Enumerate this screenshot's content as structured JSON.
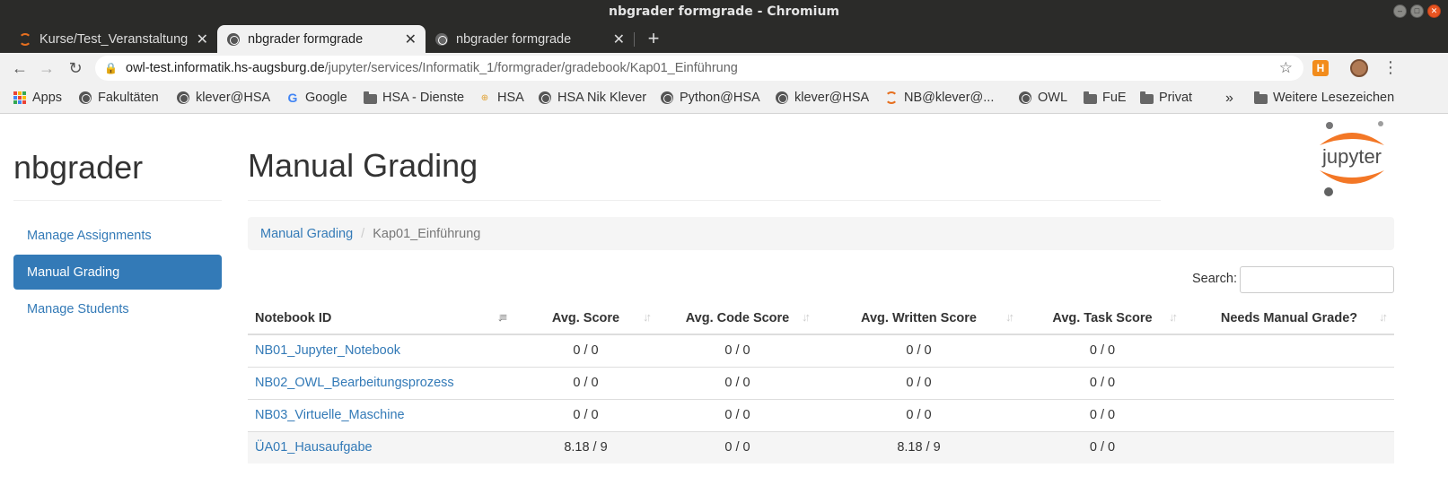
{
  "window": {
    "title": "nbgrader formgrade - Chromium"
  },
  "tabs": [
    {
      "label": "Kurse/Test_Veranstaltung",
      "icon": "jupyter-ring-icon"
    },
    {
      "label": "nbgrader formgrade",
      "icon": "globe-icon"
    },
    {
      "label": "nbgrader formgrade",
      "icon": "globe-icon"
    }
  ],
  "address": {
    "host": "owl-test.informatik.hs-augsburg.de",
    "path": "/jupyter/services/Informatik_1/formgrader/gradebook/Kap01_Einführung"
  },
  "bookmarks": [
    {
      "label": "Apps",
      "icon": "apps-grid-icon"
    },
    {
      "label": "Fakultäten",
      "icon": "globe-icon"
    },
    {
      "label": "klever@HSA",
      "icon": "globe-icon"
    },
    {
      "label": "Google",
      "icon": "google-icon"
    },
    {
      "label": "HSA - Dienste",
      "icon": "folder-icon"
    },
    {
      "label": "HSA",
      "icon": "hsa-icon"
    },
    {
      "label": "HSA Nik Klever",
      "icon": "globe-icon"
    },
    {
      "label": "Python@HSA",
      "icon": "globe-icon"
    },
    {
      "label": "klever@HSA",
      "icon": "globe-icon"
    },
    {
      "label": "NB@klever@...",
      "icon": "jupyter-ring-icon"
    },
    {
      "label": "OWL",
      "icon": "globe-icon"
    },
    {
      "label": "FuE",
      "icon": "folder-icon"
    },
    {
      "label": "Privat",
      "icon": "folder-icon"
    }
  ],
  "bookmarks_overflow": "»",
  "other_bookmarks": "Weitere Lesezeichen",
  "app": {
    "brand": "nbgrader",
    "title": "Manual Grading",
    "logo_text": "jupyter"
  },
  "sidebar": {
    "items": [
      {
        "label": "Manage Assignments",
        "active": false
      },
      {
        "label": "Manual Grading",
        "active": true
      },
      {
        "label": "Manage Students",
        "active": false
      }
    ]
  },
  "breadcrumb": {
    "root": "Manual Grading",
    "separator": "/",
    "current": "Kap01_Einführung"
  },
  "search": {
    "label": "Search:",
    "value": ""
  },
  "table": {
    "columns": [
      "Notebook ID",
      "Avg. Score",
      "Avg. Code Score",
      "Avg. Written Score",
      "Avg. Task Score",
      "Needs Manual Grade?"
    ],
    "rows": [
      [
        "NB01_Jupyter_Notebook",
        "0 / 0",
        "0 / 0",
        "0 / 0",
        "0 / 0",
        ""
      ],
      [
        "NB02_OWL_Bearbeitungsprozess",
        "0 / 0",
        "0 / 0",
        "0 / 0",
        "0 / 0",
        ""
      ],
      [
        "NB03_Virtuelle_Maschine",
        "0 / 0",
        "0 / 0",
        "0 / 0",
        "0 / 0",
        ""
      ],
      [
        "ÜA01_Hausaufgabe",
        "8.18 / 9",
        "0 / 0",
        "8.18 / 9",
        "0 / 0",
        ""
      ]
    ]
  },
  "colors": {
    "link": "#337ab7",
    "active_nav": "#337ab7",
    "chrome_dark": "#2b2b29",
    "jupyter_orange": "#e66f1f"
  }
}
